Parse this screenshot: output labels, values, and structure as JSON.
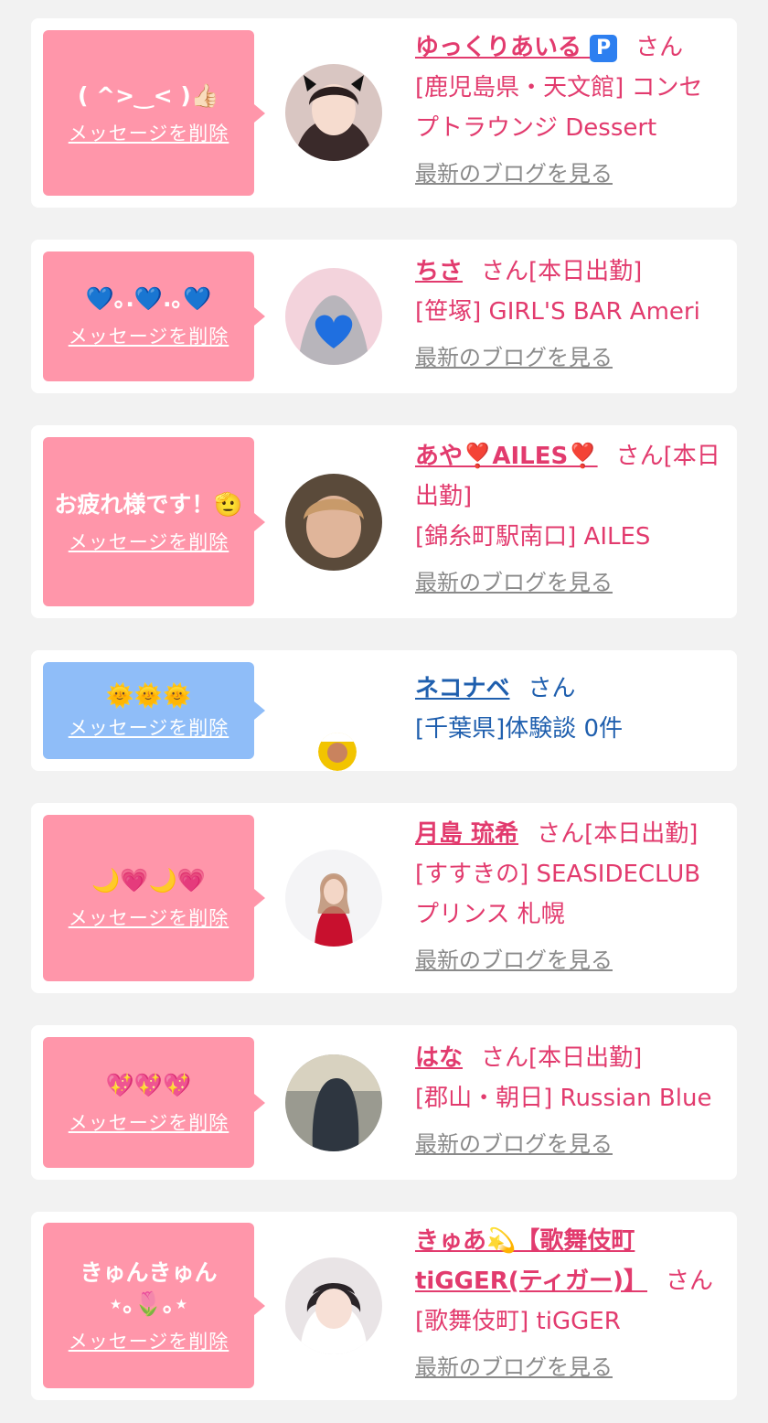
{
  "delete_label": "メッセージを削除",
  "san_label": "さん",
  "blog_label": "最新のブログを見る",
  "colors": {
    "pink_bubble": "#ff96aa",
    "blue_bubble": "#8fbdf8",
    "pink_text": "#e23b6e",
    "blue_text": "#1f5fae"
  },
  "cards": [
    {
      "message": "( ^>‿< )👍🏻",
      "name": "ゆっくりあいる",
      "name_icon": "P",
      "status": "",
      "shop": "[鹿児島県・天文館] コンセプトラウンジ Dessert",
      "avatar_icon": "girl-avatar-icon"
    },
    {
      "message": "💙｡.💙.｡💙",
      "name": "ちさ",
      "status": "[本日出勤]",
      "shop": "[笹塚] GIRL'S BAR Ameri",
      "avatar_icon": "girl-avatar-icon"
    },
    {
      "message": "お疲れ様です！🫡",
      "name": "あや❣️AILES❣️",
      "status": "[本日出勤]",
      "shop": "[錦糸町駅南口] AILES",
      "avatar_icon": "girl-avatar-icon"
    },
    {
      "message": "🌞🌞🌞",
      "name": "ネコナベ",
      "status": "",
      "shop": "[千葉県]体験談 0件",
      "avatar_icon": "user-avatar-icon"
    },
    {
      "message": "🌙💗🌙💗",
      "name": "月島 琉希",
      "status": "[本日出勤]",
      "shop": "[すすきの] SEASIDECLUB プリンス 札幌",
      "avatar_icon": "girl-avatar-icon"
    },
    {
      "message": "💖💖💖",
      "name": "はな",
      "status": "[本日出勤]",
      "shop": "[郡山・朝日] Russian Blue",
      "avatar_icon": "girl-avatar-icon"
    },
    {
      "message": "きゅんきゅん\n⋆｡🌷｡⋆",
      "name": "きゅあ💫【歌舞伎町tiGGER(ティガー)】",
      "status": "",
      "shop": "[歌舞伎町] tiGGER",
      "avatar_icon": "girl-avatar-icon"
    }
  ]
}
